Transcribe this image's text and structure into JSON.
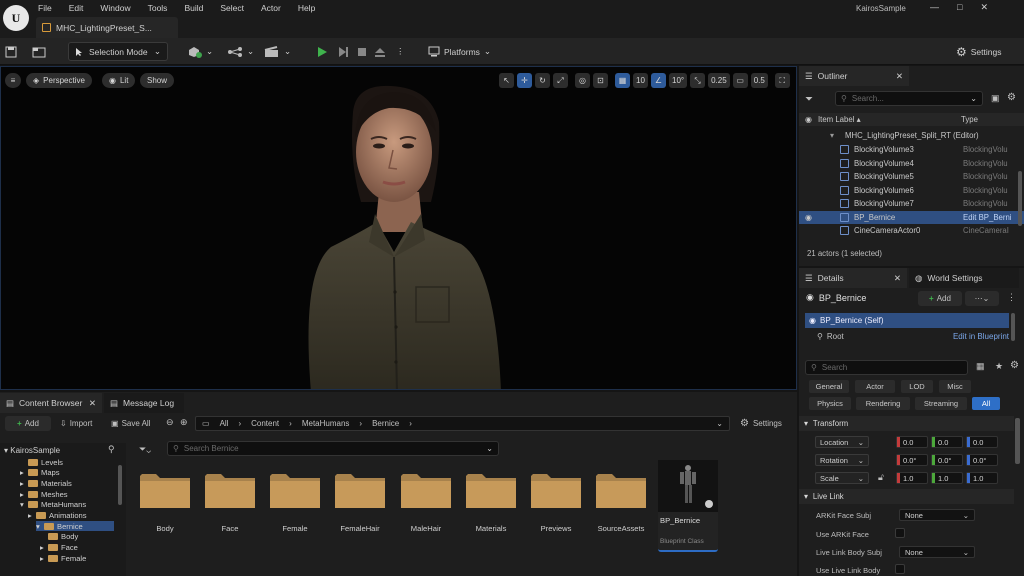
{
  "menu": [
    "File",
    "Edit",
    "Window",
    "Tools",
    "Build",
    "Select",
    "Actor",
    "Help"
  ],
  "map_tab": "MHC_LightingPreset_S...",
  "project_name": "KairosSample",
  "window_controls": {
    "minimize": "—",
    "maximize": "□",
    "close": "✕"
  },
  "toolbar": {
    "selection_mode": "Selection Mode",
    "platforms": "Platforms",
    "settings": "Settings"
  },
  "viewport": {
    "perspective": "Perspective",
    "lit": "Lit",
    "show": "Show",
    "grid_snap": "10",
    "rot_snap": "10°",
    "scale_snap": "0.25",
    "camera_speed": "0.5"
  },
  "outliner": {
    "tab": "Outliner",
    "search_placeholder": "Search...",
    "col_label": "Item Label ▴",
    "col_type": "Type",
    "root": "MHC_LightingPreset_Split_RT (Editor)",
    "rows": [
      {
        "name": "BlockingVolume3",
        "type": "BlockingVolu"
      },
      {
        "name": "BlockingVolume4",
        "type": "BlockingVolu"
      },
      {
        "name": "BlockingVolume5",
        "type": "BlockingVolu"
      },
      {
        "name": "BlockingVolume6",
        "type": "BlockingVolu"
      },
      {
        "name": "BlockingVolume7",
        "type": "BlockingVolu"
      },
      {
        "name": "BP_Bernice",
        "type": "Edit BP_Berni"
      },
      {
        "name": "CineCameraActor0",
        "type": "CineCameraI"
      }
    ],
    "status": "21 actors (1 selected)"
  },
  "details": {
    "tab": "Details",
    "tab2": "World Settings",
    "actor": "BP_Bernice",
    "add": "Add",
    "self": "BP_Bernice (Self)",
    "root": "Root",
    "edit_bp": "Edit in Blueprint",
    "search_placeholder": "Search",
    "categories_row1": [
      "General",
      "Actor",
      "LOD",
      "Misc"
    ],
    "categories_row2": [
      "Physics",
      "Rendering",
      "Streaming",
      "All"
    ],
    "transform": {
      "title": "Transform",
      "location": {
        "label": "Location",
        "x": "0.0",
        "y": "0.0",
        "z": "0.0"
      },
      "rotation": {
        "label": "Rotation",
        "x": "0.0°",
        "y": "0.0°",
        "z": "0.0°"
      },
      "scale": {
        "label": "Scale",
        "x": "1.0",
        "y": "1.0",
        "z": "1.0"
      }
    },
    "live_link": {
      "title": "Live Link",
      "face_subj": "ARKit Face Subj",
      "face_subj_val": "None",
      "use_face": "Use ARKit Face",
      "body_subj": "Live Link Body Subj",
      "body_subj_val": "None",
      "use_body": "Use Live Link Body"
    }
  },
  "content_browser": {
    "tab": "Content Browser",
    "tab2": "Message Log",
    "add": "Add",
    "import": "Import",
    "save_all": "Save All",
    "path": [
      "All",
      "Content",
      "MetaHumans",
      "Bernice"
    ],
    "settings": "Settings",
    "search_placeholder": "Search Bernice",
    "tree_root": "KairosSample",
    "tree": [
      "Levels",
      "Maps",
      "Materials",
      "Meshes",
      "MetaHumans",
      "Animations",
      "Bernice",
      "Body",
      "Face",
      "Female"
    ],
    "assets": [
      "Body",
      "Face",
      "Female",
      "FemaleHair",
      "MaleHair",
      "Materials",
      "Previews",
      "SourceAssets"
    ],
    "bp_asset": "BP_Bernice",
    "bp_type": "Blueprint Class"
  }
}
